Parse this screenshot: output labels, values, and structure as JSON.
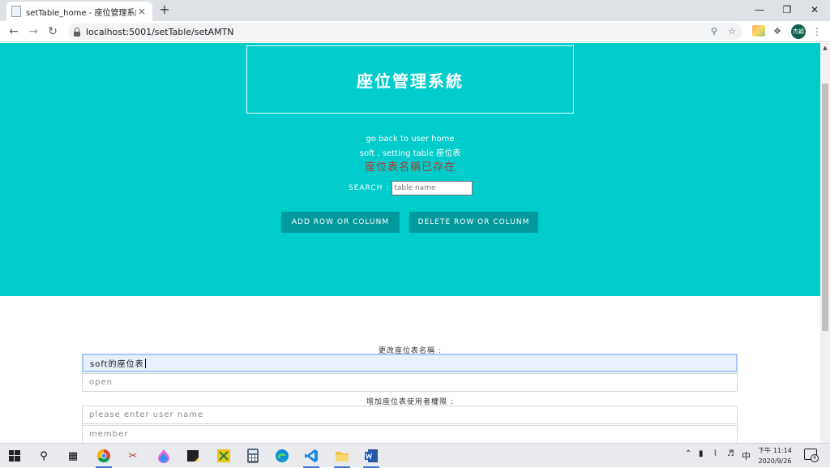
{
  "browser": {
    "tab_title": "setTable_home - 座位管理系統",
    "tab_close": "×",
    "new_tab": "+",
    "url": "localhost:5001/setTable/setAMTN",
    "window_controls": {
      "minimize": "—",
      "maximize": "❐",
      "close": "✕"
    },
    "profile_label": "杰穎"
  },
  "hero": {
    "title": "座位管理系統",
    "back_link": "go back to user home",
    "table_link": "soft , setting table 座位表",
    "error_message": "座位表名稱已存在",
    "search_label": "SEARCH :",
    "search_placeholder": "table name",
    "add_button": "ADD ROW OR COLUNM",
    "delete_button": "DELETE ROW OR COLUNM",
    "bg_color": "#00cccc",
    "button_color": "#00999e",
    "error_color": "#b03a2e"
  },
  "form": {
    "rename_label": "更改座位表名稱 :",
    "name_value": "soft的座位表",
    "status_value": "open",
    "add_user_label": "增加座位表使用者權限 :",
    "user_placeholder": "please enter user name",
    "member_value": "member"
  },
  "taskbar": {
    "tray_ime": "中",
    "clock_time": "下午 11:14",
    "clock_date": "2020/9/26",
    "notification_count": "4"
  }
}
